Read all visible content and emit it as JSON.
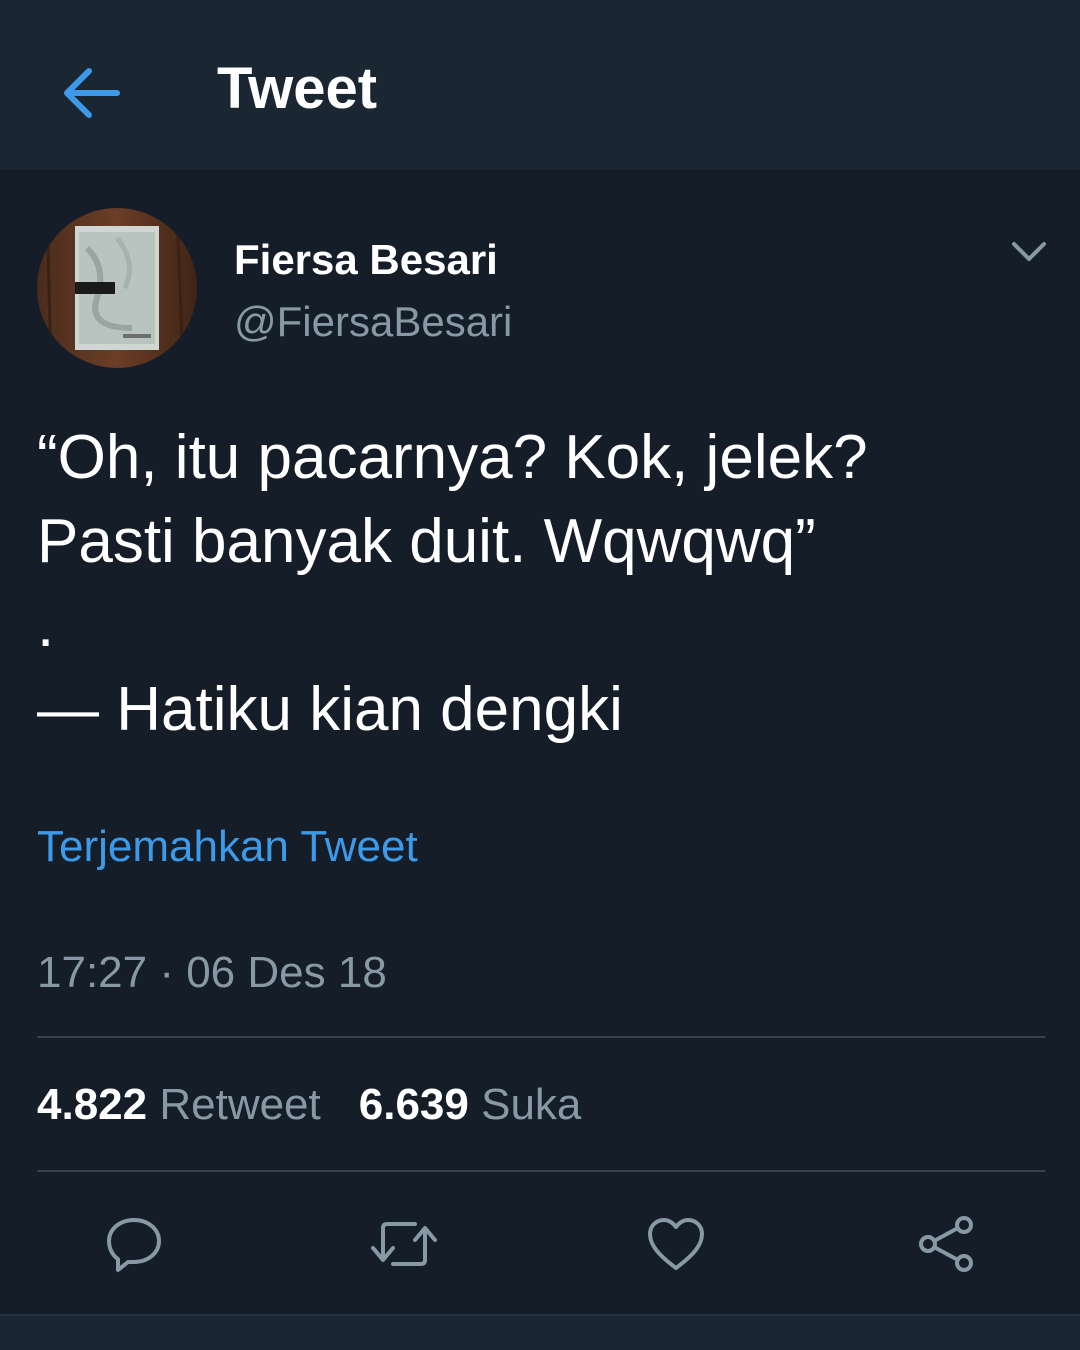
{
  "header": {
    "back_icon": "arrow-left-icon",
    "title": "Tweet"
  },
  "tweet": {
    "author_name": "Fiersa Besari",
    "author_handle": "@FiersaBesari",
    "lines": [
      "“Oh, itu pacarnya? Kok, jelek?",
      "Pasti banyak duit. Wqwqwq”",
      ".",
      "— Hatiku kian dengki"
    ],
    "translate_label": "Terjemahkan Tweet",
    "timestamp": "17:27 · 06 Des 18"
  },
  "stats": {
    "retweet_count": "4.822",
    "retweet_label": "Retweet",
    "like_count": "6.639",
    "like_label": "Suka"
  },
  "actions": {
    "icons": [
      "reply-icon",
      "retweet-icon",
      "like-icon",
      "share-icon"
    ]
  },
  "colors": {
    "background": "#151d28",
    "header": "#1b2633",
    "accent": "#3d9ae8",
    "muted": "#8899a6",
    "divider": "#38444d"
  }
}
